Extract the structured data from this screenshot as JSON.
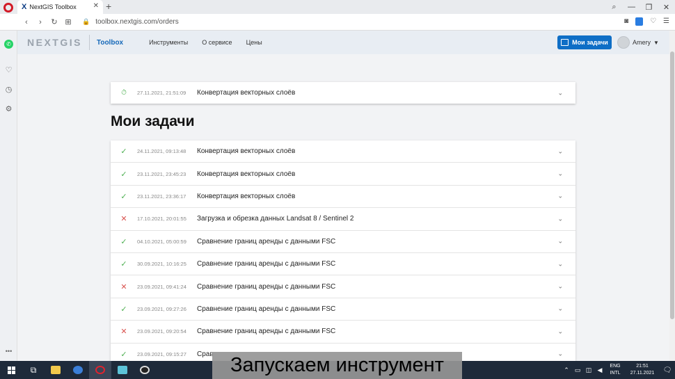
{
  "browser": {
    "tab_title": "NextGIS Toolbox",
    "tab_close": "✕",
    "new_tab": "+",
    "url": "toolbox.nextgis.com/orders",
    "back": "‹",
    "forward": "›",
    "reload": "↻",
    "window_controls": [
      "⌕",
      "—",
      "❐",
      "✕"
    ]
  },
  "header": {
    "brand": "NEXTGIS",
    "brand_sub": "Toolbox",
    "menu": [
      "Инструменты",
      "О сервисе",
      "Цены"
    ],
    "tasks_button": "Мои задачи",
    "user": "Amery"
  },
  "running_task": {
    "timestamp": "27.11.2021, 21:51:09",
    "name": "Конвертация векторных слоёв",
    "status": "pending"
  },
  "page_title": "Мои задачи",
  "tasks": [
    {
      "status": "ok",
      "timestamp": "24.11.2021, 09:13:48",
      "name": "Конвертация векторных слоёв"
    },
    {
      "status": "ok",
      "timestamp": "23.11.2021, 23:45:23",
      "name": "Конвертация векторных слоёв"
    },
    {
      "status": "ok",
      "timestamp": "23.11.2021, 23:36:17",
      "name": "Конвертация векторных слоёв"
    },
    {
      "status": "fail",
      "timestamp": "17.10.2021, 20:01:55",
      "name": "Загрузка и обрезка данных Landsat 8 / Sentinel 2"
    },
    {
      "status": "ok",
      "timestamp": "04.10.2021, 05:00:59",
      "name": "Сравнение границ аренды с данными FSC"
    },
    {
      "status": "ok",
      "timestamp": "30.09.2021, 10:16:25",
      "name": "Сравнение границ аренды с данными FSC"
    },
    {
      "status": "fail",
      "timestamp": "23.09.2021, 09:41:24",
      "name": "Сравнение границ аренды с данными FSC"
    },
    {
      "status": "ok",
      "timestamp": "23.09.2021, 09:27:26",
      "name": "Сравнение границ аренды с данными FSC"
    },
    {
      "status": "fail",
      "timestamp": "23.09.2021, 09:20:54",
      "name": "Сравнение границ аренды с данными FSC"
    },
    {
      "status": "ok",
      "timestamp": "23.09.2021, 09:15:27",
      "name": "Срав"
    }
  ],
  "subtitle": "Запускаем инструмент",
  "taskbar": {
    "lang_top": "ENG",
    "lang_bottom": "INTL",
    "time": "21:51",
    "date": "27.11.2021"
  },
  "colors": {
    "accent": "#0e6ec6",
    "ok": "#4caf50",
    "fail": "#d9534f"
  }
}
